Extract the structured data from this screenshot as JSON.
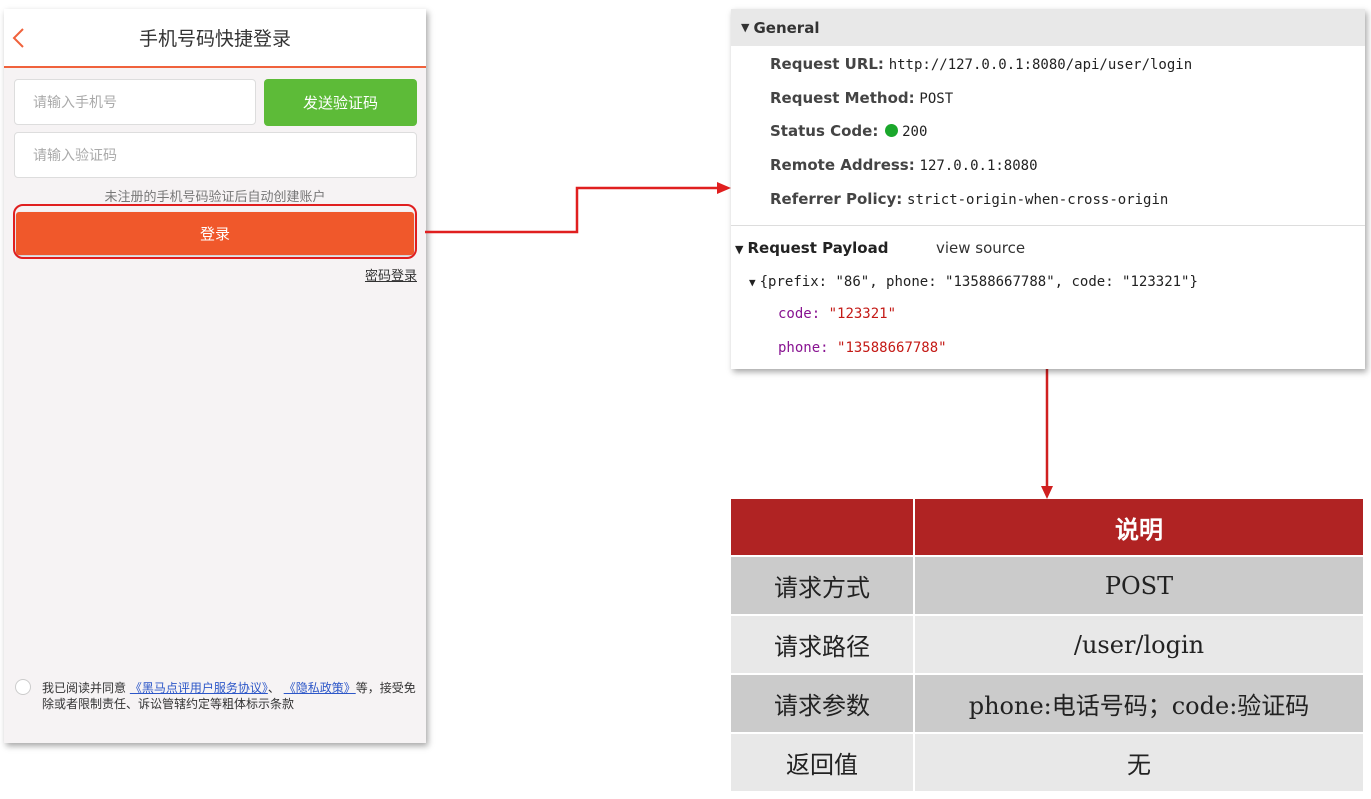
{
  "phone": {
    "title": "手机号码快捷登录",
    "phone_placeholder": "请输入手机号",
    "send_code_label": "发送验证码",
    "code_placeholder": "请输入验证码",
    "hint": "未注册的手机号码验证后自动创建账户",
    "login_label": "登录",
    "password_login_label": "密码登录",
    "agreement": {
      "prefix": "我已阅读并同意",
      "link1": "《黑马点评用户服务协议》",
      "sep": "、",
      "link2": "《隐私政策》",
      "suffix": "等，接受免除或者限制责任、诉讼管辖约定等粗体标示条款"
    }
  },
  "devtools": {
    "general_label": "General",
    "request_url_key": "Request URL:",
    "request_url": "http://127.0.0.1:8080/api/user/login",
    "request_method_key": "Request Method:",
    "request_method": "POST",
    "status_code_key": "Status Code:",
    "status_code": "200",
    "remote_address_key": "Remote Address:",
    "remote_address": "127.0.0.1:8080",
    "referrer_policy_key": "Referrer Policy:",
    "referrer_policy": "strict-origin-when-cross-origin",
    "payload_label": "Request Payload",
    "view_source_label": "view source",
    "payload_summary": "{prefix: \"86\", phone: \"13588667788\", code: \"123321\"}",
    "code_key": "code:",
    "code_value": "\"123321\"",
    "phone_key": "phone:",
    "phone_value": "\"13588667788\""
  },
  "table": {
    "header_empty": "",
    "header": "说明",
    "rows": [
      {
        "label": "请求方式",
        "value": "POST"
      },
      {
        "label": "请求路径",
        "value": "/user/login"
      },
      {
        "label": "请求参数",
        "value": "phone:电话号码；code:验证码"
      },
      {
        "label": "返回值",
        "value": "无"
      }
    ]
  },
  "colors": {
    "accent_orange": "#f0582b",
    "send_green": "#5dbb38",
    "highlight_red": "#e01f1f",
    "table_header": "#b02323",
    "status_green": "#1aa72b"
  }
}
